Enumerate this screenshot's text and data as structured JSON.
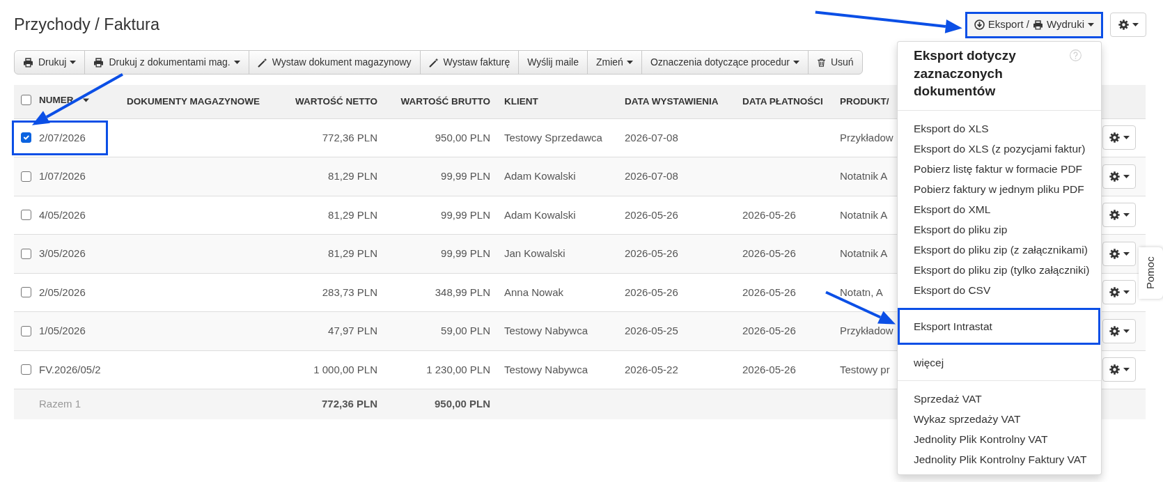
{
  "page": {
    "title": "Przychody / Faktura"
  },
  "export_button": {
    "label_export": "Eksport /",
    "label_prints": "Wydruki",
    "expanded": true,
    "highlighted": true
  },
  "toolbar": [
    {
      "label": "Drukuj",
      "kind": "print",
      "has_menu": true
    },
    {
      "label": "Drukuj z dokumentami mag.",
      "kind": "print",
      "has_menu": true
    },
    {
      "label": "Wystaw dokument magazynowy",
      "kind": "create",
      "has_menu": false
    },
    {
      "label": "Wystaw fakturę",
      "kind": "create",
      "has_menu": false
    },
    {
      "label": "Wyślij maile",
      "kind": "plain",
      "has_menu": false
    },
    {
      "label": "Zmień",
      "kind": "plain",
      "has_menu": true
    },
    {
      "label": "Oznaczenia dotyczące procedur",
      "kind": "plain",
      "has_menu": true
    },
    {
      "label": "Usuń",
      "kind": "delete",
      "has_menu": false
    }
  ],
  "table": {
    "all_selected": false,
    "columns": [
      {
        "label": "NUMER",
        "sorted": true
      },
      {
        "label": "DOKUMENTY MAGAZYNOWE",
        "sorted": false
      },
      {
        "label": "WARTOŚĆ NETTO",
        "sorted": false
      },
      {
        "label": "WARTOŚĆ BRUTTO",
        "sorted": false
      },
      {
        "label": "KLIENT",
        "sorted": false
      },
      {
        "label": "DATA WYSTAWIENIA",
        "sorted": false
      },
      {
        "label": "DATA PŁATNOŚCI",
        "sorted": false
      },
      {
        "label": "PRODUKT/",
        "sorted": false
      }
    ],
    "rows": [
      {
        "selected": true,
        "highlighted": true,
        "number": "2/07/2026",
        "net": "772,36 PLN",
        "gross": "950,00 PLN",
        "client": "Testowy Sprzedawca",
        "issue_date": "2026-07-08",
        "product": "Przykładow"
      },
      {
        "selected": false,
        "highlighted": false,
        "number": "1/07/2026",
        "net": "81,29 PLN",
        "gross": "99,99 PLN",
        "client": "Adam Kowalski",
        "issue_date": "2026-07-08",
        "product": "Notatnik A"
      },
      {
        "selected": false,
        "highlighted": false,
        "number": "4/05/2026",
        "net": "81,29 PLN",
        "gross": "99,99 PLN",
        "client": "Adam Kowalski",
        "issue_date": "2026-05-26",
        "payment_date": "2026-05-26",
        "product": "Notatnik A"
      },
      {
        "selected": false,
        "highlighted": false,
        "number": "3/05/2026",
        "net": "81,29 PLN",
        "gross": "99,99 PLN",
        "client": "Jan Kowalski",
        "issue_date": "2026-05-26",
        "payment_date": "2026-05-26",
        "product": "Notatnik A"
      },
      {
        "selected": false,
        "highlighted": false,
        "number": "2/05/2026",
        "net": "283,73 PLN",
        "gross": "348,99 PLN",
        "client": "Anna Nowak",
        "issue_date": "2026-05-26",
        "payment_date": "2026-05-26",
        "product": "Notatn, A"
      },
      {
        "selected": false,
        "highlighted": false,
        "number": "1/05/2026",
        "net": "47,97 PLN",
        "gross": "59,00 PLN",
        "client": "Testowy Nabywca",
        "issue_date": "2026-05-25",
        "payment_date": "2026-05-26",
        "product": "Przykładow"
      },
      {
        "selected": false,
        "highlighted": false,
        "number": "FV.2026/05/2",
        "net": "1 000,00 PLN",
        "gross": "1 230,00 PLN",
        "client": "Testowy Nabywca",
        "issue_date": "2026-05-22",
        "payment_date": "2026-05-26",
        "product": "Testowy pr"
      }
    ],
    "totals": {
      "label": "Razem 1",
      "net": "772,36 PLN",
      "gross": "950,00 PLN"
    }
  },
  "export_menu": {
    "heading": "Eksport dotyczy zaznaczonych dokumentów",
    "groups": [
      {
        "separated": true,
        "items": [
          {
            "label": "Eksport do XLS",
            "highlighted": false
          },
          {
            "label": "Eksport do XLS (z pozycjami faktur)",
            "highlighted": false
          },
          {
            "label": "Pobierz listę faktur w formacie PDF",
            "highlighted": false
          },
          {
            "label": "Pobierz faktury w jednym pliku PDF",
            "highlighted": false
          },
          {
            "label": "Eksport do XML",
            "highlighted": false
          },
          {
            "label": "Eksport do pliku zip",
            "highlighted": false
          },
          {
            "label": "Eksport do pliku zip (z załącznikami)",
            "highlighted": false
          },
          {
            "label": "Eksport do pliku zip (tylko załączniki)",
            "highlighted": false
          },
          {
            "label": "Eksport do CSV",
            "highlighted": false
          }
        ]
      },
      {
        "separated": false,
        "items": [
          {
            "label": "Eksport Intrastat",
            "highlighted": true
          }
        ]
      },
      {
        "separated": false,
        "items": [
          {
            "label": "więcej",
            "highlighted": false
          }
        ]
      },
      {
        "separated": true,
        "items": [
          {
            "label": "Sprzedaż VAT",
            "highlighted": false
          },
          {
            "label": "Wykaz sprzedaży VAT",
            "highlighted": false
          },
          {
            "label": "Jednolity Plik Kontrolny VAT",
            "highlighted": false
          },
          {
            "label": "Jednolity Plik Kontrolny Faktury VAT",
            "highlighted": false
          }
        ]
      }
    ]
  },
  "help_tab": {
    "label": "Pomoc"
  }
}
